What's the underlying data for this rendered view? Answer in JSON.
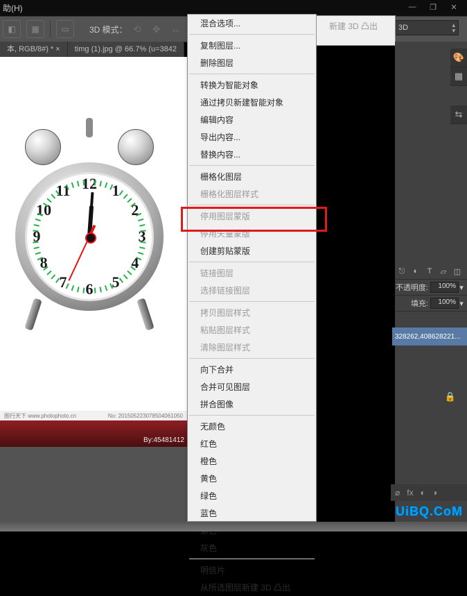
{
  "window": {
    "min": "—",
    "max": "❐",
    "close": "✕"
  },
  "menu": {
    "help": "助(H)"
  },
  "toolbar": {
    "mode_label": "3D 模式："
  },
  "dropdown3d": {
    "value": "3D"
  },
  "tabs": [
    "本, RGB/8#) * ×",
    "timg (1).jpg @ 66.7% (u=3842"
  ],
  "submenu": {
    "item": "新建 3D 凸出"
  },
  "context": [
    {
      "t": "混合选项...",
      "d": false
    },
    {
      "sep": true
    },
    {
      "t": "复制图层...",
      "d": false
    },
    {
      "t": "删除图层",
      "d": false
    },
    {
      "sep": true
    },
    {
      "t": "转换为智能对象",
      "d": false
    },
    {
      "t": "通过拷贝新建智能对象",
      "d": false
    },
    {
      "t": "编辑内容",
      "d": false
    },
    {
      "t": "导出内容...",
      "d": false
    },
    {
      "t": "替换内容...",
      "d": false
    },
    {
      "sep": true
    },
    {
      "t": "栅格化图层",
      "d": false
    },
    {
      "t": "栅格化图层样式",
      "d": true
    },
    {
      "sep": true
    },
    {
      "t": "停用图层蒙版",
      "d": true
    },
    {
      "t": "停用矢量蒙版",
      "d": true
    },
    {
      "t": "创建剪贴蒙版",
      "d": false
    },
    {
      "sep": true
    },
    {
      "t": "链接图层",
      "d": true
    },
    {
      "t": "选择链接图层",
      "d": true
    },
    {
      "sep": true
    },
    {
      "t": "拷贝图层样式",
      "d": true
    },
    {
      "t": "粘贴图层样式",
      "d": true
    },
    {
      "t": "清除图层样式",
      "d": true
    },
    {
      "sep": true
    },
    {
      "t": "向下合并",
      "d": false
    },
    {
      "t": "合并可见图层",
      "d": false
    },
    {
      "t": "拼合图像",
      "d": false
    },
    {
      "sep": true
    },
    {
      "t": "无颜色",
      "d": false
    },
    {
      "t": "红色",
      "d": false
    },
    {
      "t": "橙色",
      "d": false
    },
    {
      "t": "黄色",
      "d": false
    },
    {
      "t": "绿色",
      "d": false
    },
    {
      "t": "蓝色",
      "d": false
    },
    {
      "t": "紫色",
      "d": false
    },
    {
      "t": "灰色",
      "d": false
    },
    {
      "sep": true
    },
    {
      "t": "明信片",
      "d": false
    },
    {
      "t": "从所选图层新建 3D 凸出",
      "d": false
    }
  ],
  "layers": {
    "opacity_label": "不透明度:",
    "opacity_value": "100%",
    "fill_label": "填充:",
    "fill_value": "100%",
    "selected": "328262,408628221..."
  },
  "canvas": {
    "site": "图行天下 www.photophoto.cn",
    "serial": "No: 201505223078504061050",
    "by": "By:45481412"
  },
  "clock": {
    "nums": [
      "12",
      "1",
      "2",
      "3",
      "4",
      "5",
      "6",
      "7",
      "8",
      "9",
      "10",
      "11"
    ]
  },
  "logo": "UiBQ.CoM"
}
